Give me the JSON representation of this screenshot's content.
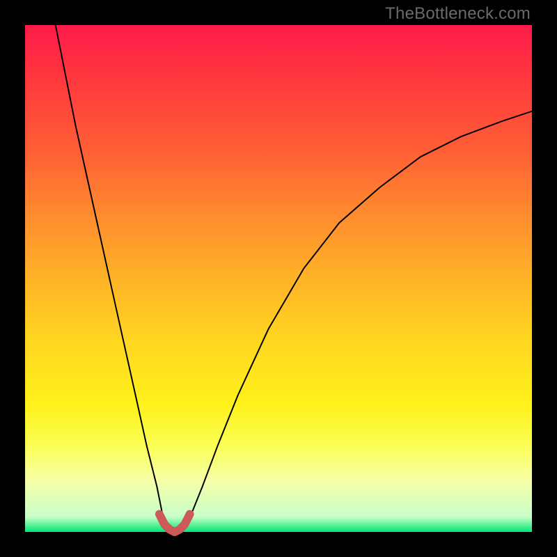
{
  "watermark": "TheBottleneck.com",
  "chart_data": {
    "type": "line",
    "title": "",
    "xlabel": "",
    "ylabel": "",
    "xlim": [
      0,
      100
    ],
    "ylim": [
      0,
      100
    ],
    "legend_position": "none",
    "grid": false,
    "background": "rainbow-gradient-vertical",
    "series": [
      {
        "name": "bottleneck-curve",
        "color": "#000000",
        "stroke_width": 2,
        "x": [
          6,
          10,
          14,
          18,
          22,
          24,
          26,
          27,
          28,
          29.5,
          31,
          33,
          35,
          38,
          42,
          48,
          55,
          62,
          70,
          78,
          86,
          94,
          100
        ],
        "values": [
          100,
          80,
          62,
          44,
          26,
          17,
          9,
          4,
          1,
          0,
          1,
          4,
          9,
          17,
          27,
          40,
          52,
          61,
          68,
          74,
          78,
          81,
          83
        ]
      },
      {
        "name": "highlight-segment",
        "color": "#cc5a57",
        "stroke_width": 12,
        "x": [
          26.5,
          27.5,
          28.5,
          29.5,
          30.5,
          31.5,
          32.5
        ],
        "values": [
          3.5,
          1.5,
          0.5,
          0,
          0.5,
          1.5,
          3.5
        ]
      }
    ],
    "annotations": [
      {
        "text": "TheBottleneck.com",
        "position": "top-right",
        "color": "#6a6a6a"
      }
    ]
  }
}
